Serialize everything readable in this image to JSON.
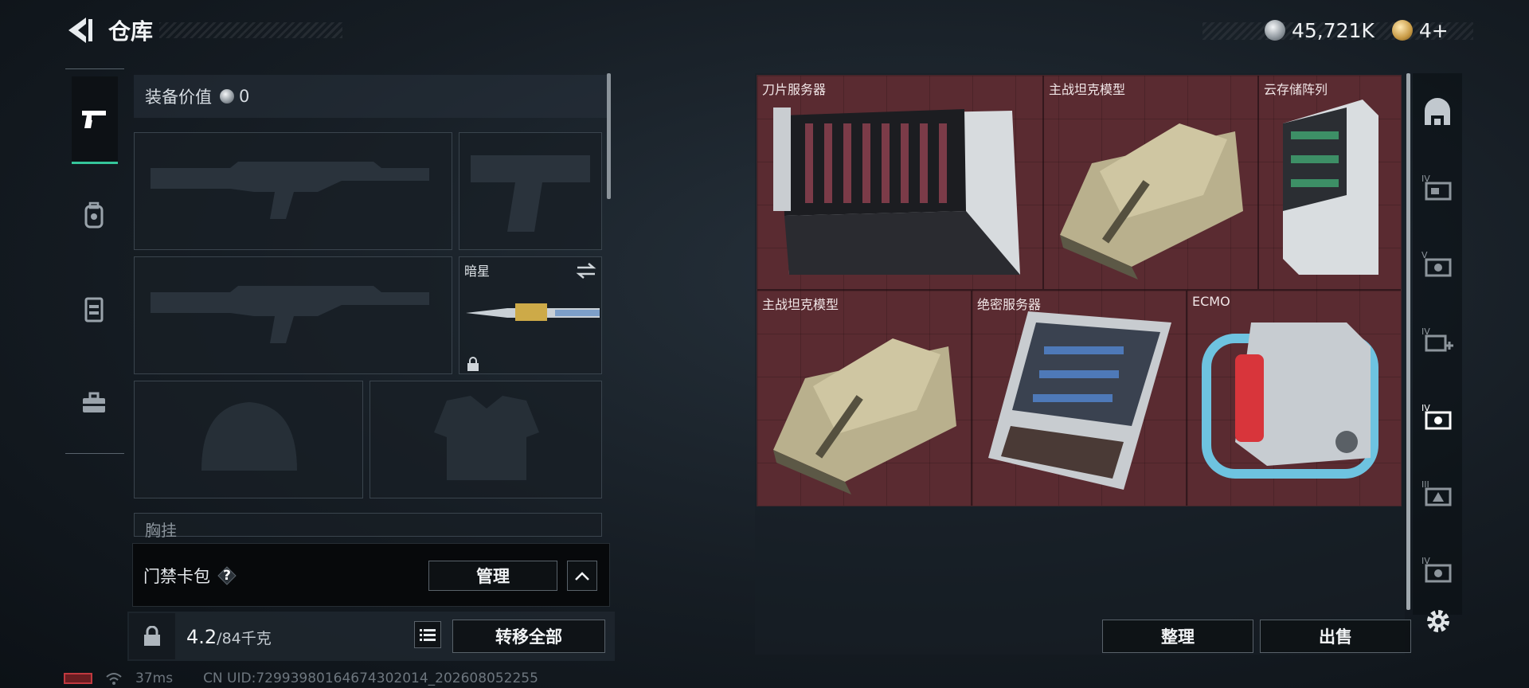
{
  "header": {
    "title": "仓库"
  },
  "currency": {
    "silver": "45,721K",
    "gold": "4+"
  },
  "left_nav": {
    "items": [
      "weapon-icon",
      "backpack-icon",
      "chest-rig-icon",
      "toolbox-icon"
    ]
  },
  "equipment": {
    "value_label": "装备价值",
    "value": "0",
    "knife": {
      "name": "暗星"
    },
    "chest_label": "胸挂"
  },
  "card_pack": {
    "label": "门禁卡包",
    "help": "?",
    "manage_label": "管理"
  },
  "weight": {
    "current": "4.2",
    "capacity": "/84千克"
  },
  "transfer_all_label": "转移全部",
  "stash": {
    "items": [
      {
        "name": "刀片服务器"
      },
      {
        "name": "主战坦克模型"
      },
      {
        "name": "云存储阵列"
      },
      {
        "name": "主战坦克模型"
      },
      {
        "name": "绝密服务器"
      },
      {
        "name": "ECMO"
      }
    ]
  },
  "actions": {
    "sort_label": "整理",
    "sell_label": "出售"
  },
  "status": {
    "ping": "37ms",
    "uid": "CN UID:7299398016467430201​4_202608052255"
  },
  "colors": {
    "accent": "#35c59a",
    "stash_bg": "#5a2b31"
  }
}
